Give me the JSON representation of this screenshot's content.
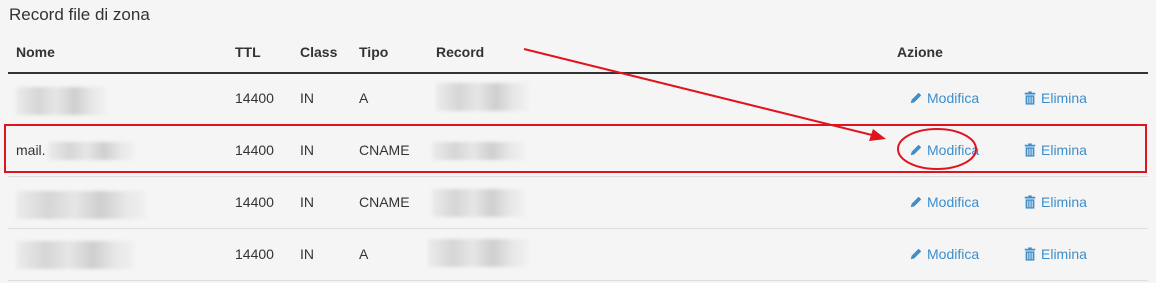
{
  "section": {
    "title": "Record file di zona"
  },
  "columns": {
    "name": "Nome",
    "ttl": "TTL",
    "class": "Class",
    "type": "Tipo",
    "record": "Record",
    "action": "Azione"
  },
  "rows": [
    {
      "name_prefix": "",
      "ttl": "14400",
      "class": "IN",
      "type": "A",
      "edit_label": "Modifica",
      "delete_label": "Elimina"
    },
    {
      "name_prefix": "mail.",
      "ttl": "14400",
      "class": "IN",
      "type": "CNAME",
      "edit_label": "Modifica",
      "delete_label": "Elimina"
    },
    {
      "name_prefix": "",
      "ttl": "14400",
      "class": "IN",
      "type": "CNAME",
      "edit_label": "Modifica",
      "delete_label": "Elimina"
    },
    {
      "name_prefix": "",
      "ttl": "14400",
      "class": "IN",
      "type": "A",
      "edit_label": "Modifica",
      "delete_label": "Elimina"
    }
  ],
  "icons": {
    "edit": "pencil-icon",
    "delete": "trash-icon"
  },
  "colors": {
    "link": "#3d8ecb",
    "annotation": "#e0141e",
    "background": "#f5f5f5"
  }
}
